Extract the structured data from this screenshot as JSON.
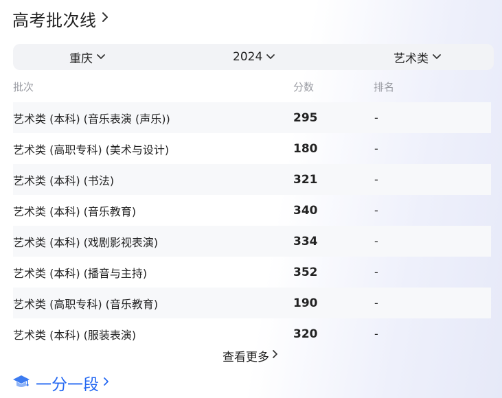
{
  "header": {
    "title": "高考批次线"
  },
  "filters": {
    "province": "重庆",
    "year": "2024",
    "category": "艺术类"
  },
  "table": {
    "columns": {
      "batch": "批次",
      "score": "分数",
      "rank": "排名"
    },
    "rows": [
      {
        "batch": "艺术类 (本科) (音乐表演 (声乐))",
        "score": "295",
        "rank": "-"
      },
      {
        "batch": "艺术类 (高职专科) (美术与设计)",
        "score": "180",
        "rank": "-"
      },
      {
        "batch": "艺术类 (本科) (书法)",
        "score": "321",
        "rank": "-"
      },
      {
        "batch": "艺术类 (本科) (音乐教育)",
        "score": "340",
        "rank": "-"
      },
      {
        "batch": "艺术类 (本科) (戏剧影视表演)",
        "score": "334",
        "rank": "-"
      },
      {
        "batch": "艺术类 (本科) (播音与主持)",
        "score": "352",
        "rank": "-"
      },
      {
        "batch": "艺术类 (高职专科) (音乐教育)",
        "score": "190",
        "rank": "-"
      },
      {
        "batch": "艺术类 (本科) (服装表演)",
        "score": "320",
        "rank": "-"
      }
    ]
  },
  "more_link": "查看更多",
  "section2": {
    "title": "一分一段",
    "icon": "graduation-cap-icon"
  },
  "colors": {
    "accent": "#2468f2",
    "filter_bg": "#f2f3f6",
    "stripe": "#f7f8fa",
    "muted": "#9a9ca3"
  }
}
